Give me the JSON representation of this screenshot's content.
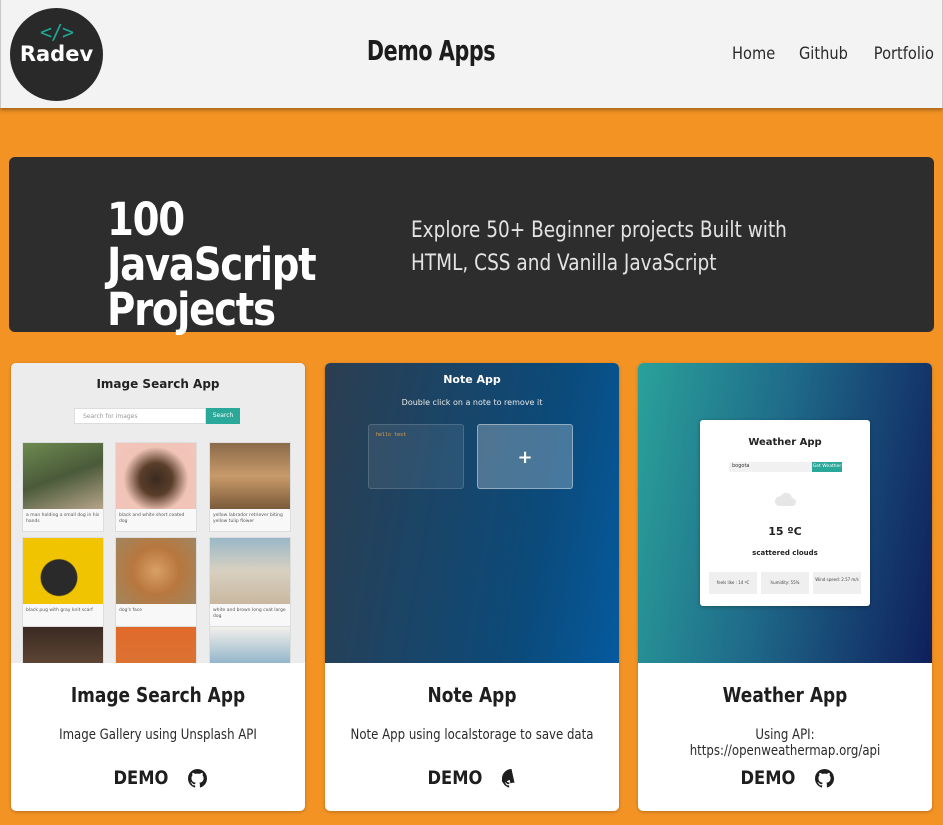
{
  "header": {
    "logo_text": "Radev",
    "logo_code": "</>",
    "title": "Demo Apps",
    "nav": [
      "Home",
      "Github",
      "Portfolio"
    ]
  },
  "hero": {
    "title": "100 JavaScript Projects",
    "subtitle": "Explore 50+ Beginner projects Built with HTML, CSS and Vanilla JavaScript"
  },
  "cards": [
    {
      "title": "Image Search App",
      "description": "Image Gallery using Unsplash API",
      "demo_label": "DEMO",
      "preview": {
        "title": "Image Search App",
        "search_placeholder": "Search for images",
        "search_button": "Search",
        "captions": [
          "a man holding a small dog in his hands",
          "black and white short coated dog",
          "yellow labrador retriever biting yellow tulip flower",
          "black pug with gray knit scarf",
          "dog's face",
          "white and brown long coat large dog"
        ]
      }
    },
    {
      "title": "Note App",
      "description": "Note App using localstorage to save data",
      "demo_label": "DEMO",
      "preview": {
        "title": "Note App",
        "subtitle": "Double click on a note to remove it",
        "note_text": "hello test",
        "add_symbol": "+"
      }
    },
    {
      "title": "Weather App",
      "description": "Using API: https://openweathermap.org/api",
      "demo_label": "DEMO",
      "preview": {
        "title": "Weather App",
        "input_value": "bogota",
        "button": "Get Weather",
        "temperature": "15 ºC",
        "condition": "scattered clouds",
        "stats": [
          "feels like : 14 ºC",
          "humidity: 55%",
          "Wind speed: 2.57 m/s"
        ]
      }
    }
  ],
  "colors": {
    "background": "#f39324",
    "header": "#f3f3f3",
    "hero": "#2d2d2d",
    "accent": "#2aa89a"
  }
}
